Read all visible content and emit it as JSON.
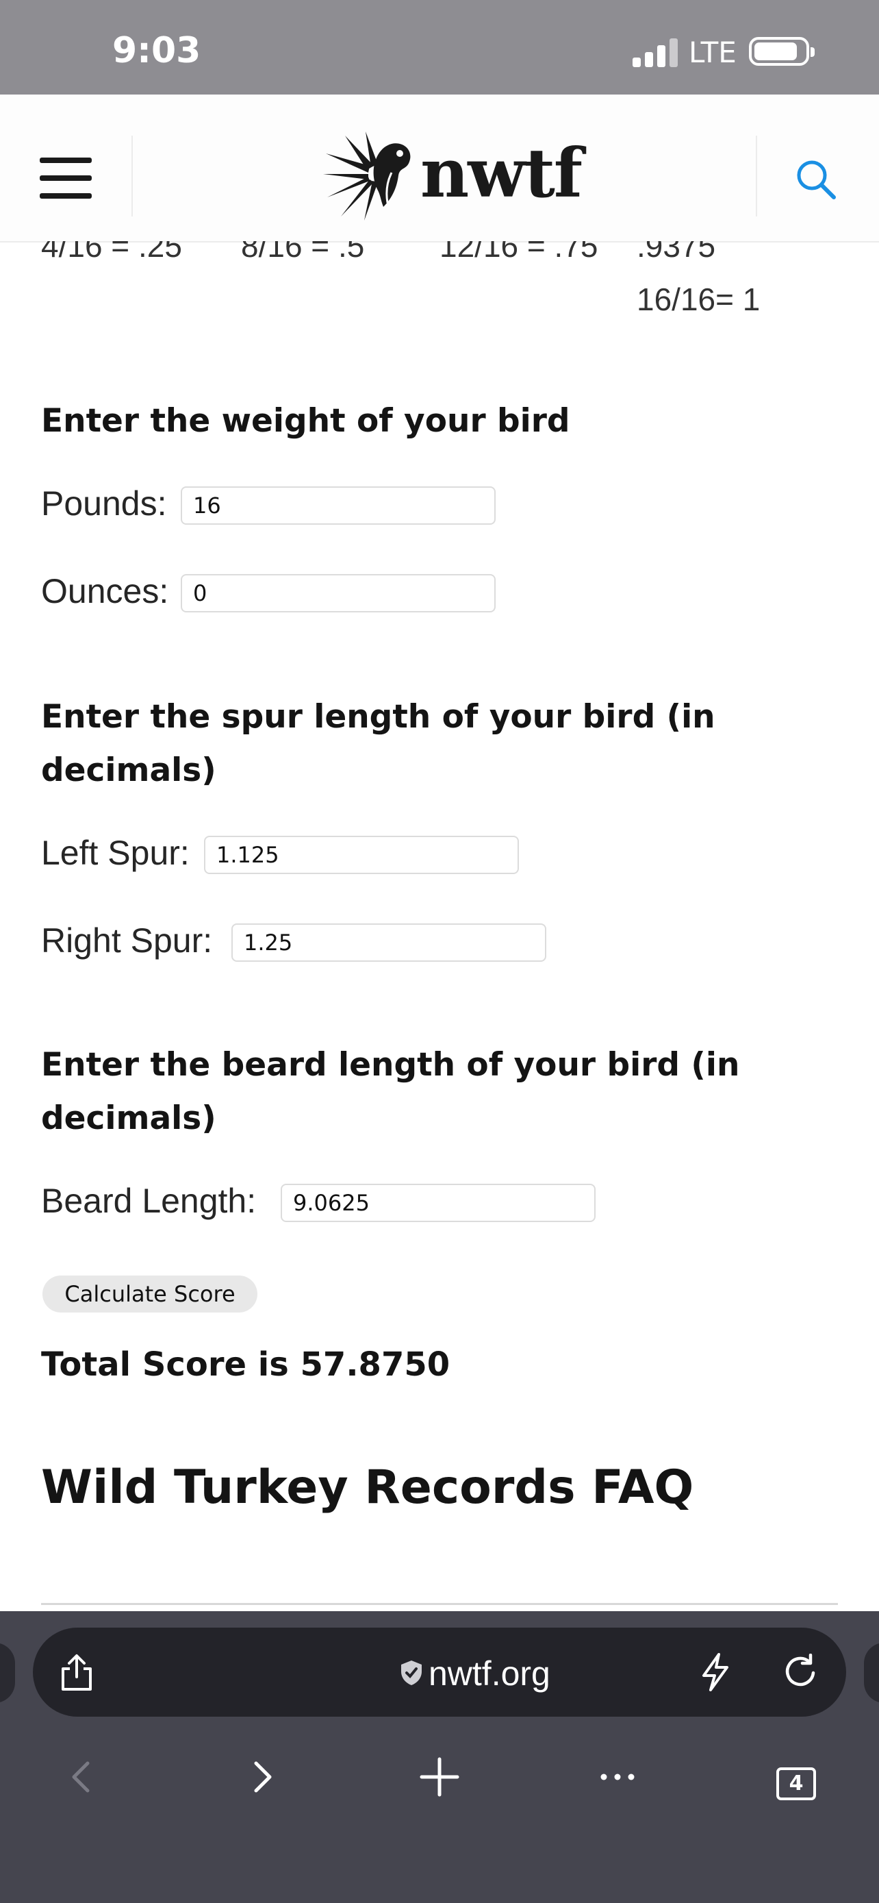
{
  "status_bar": {
    "time": "9:03",
    "network": "LTE"
  },
  "header": {
    "logo_text": "nwtf"
  },
  "fractions": [
    "4/16 = .25",
    "8/16 = .5",
    "12/16 = .75",
    ".9375",
    "16/16= 1"
  ],
  "weight_section": {
    "heading": "Enter the weight of your bird",
    "pounds_label": "Pounds:",
    "pounds_value": "16",
    "ounces_label": "Ounces:",
    "ounces_value": "0"
  },
  "spur_section": {
    "heading": "Enter the spur length of your bird (in decimals)",
    "left_label": "Left Spur:",
    "left_value": "1.125",
    "right_label": "Right Spur:",
    "right_value": "1.25"
  },
  "beard_section": {
    "heading": "Enter the beard length of your bird (in decimals)",
    "label": "Beard Length:",
    "value": "9.0625"
  },
  "calculate_label": "Calculate Score",
  "total_score": "Total Score is 57.8750",
  "faq_heading": "Wild Turkey Records FAQ",
  "browser": {
    "url": "nwtf.org",
    "tab_count": "4"
  },
  "colors": {
    "accent": "#1a8fe3",
    "status_bar": "#8e8d92",
    "toolbar": "#45454f",
    "url_bar": "#232329"
  },
  "icons": [
    "hamburger-menu-icon",
    "search-icon",
    "share-icon",
    "shield-icon",
    "bolt-icon",
    "reload-icon",
    "back-icon",
    "forward-icon",
    "plus-icon",
    "more-icon",
    "tabs-icon"
  ]
}
